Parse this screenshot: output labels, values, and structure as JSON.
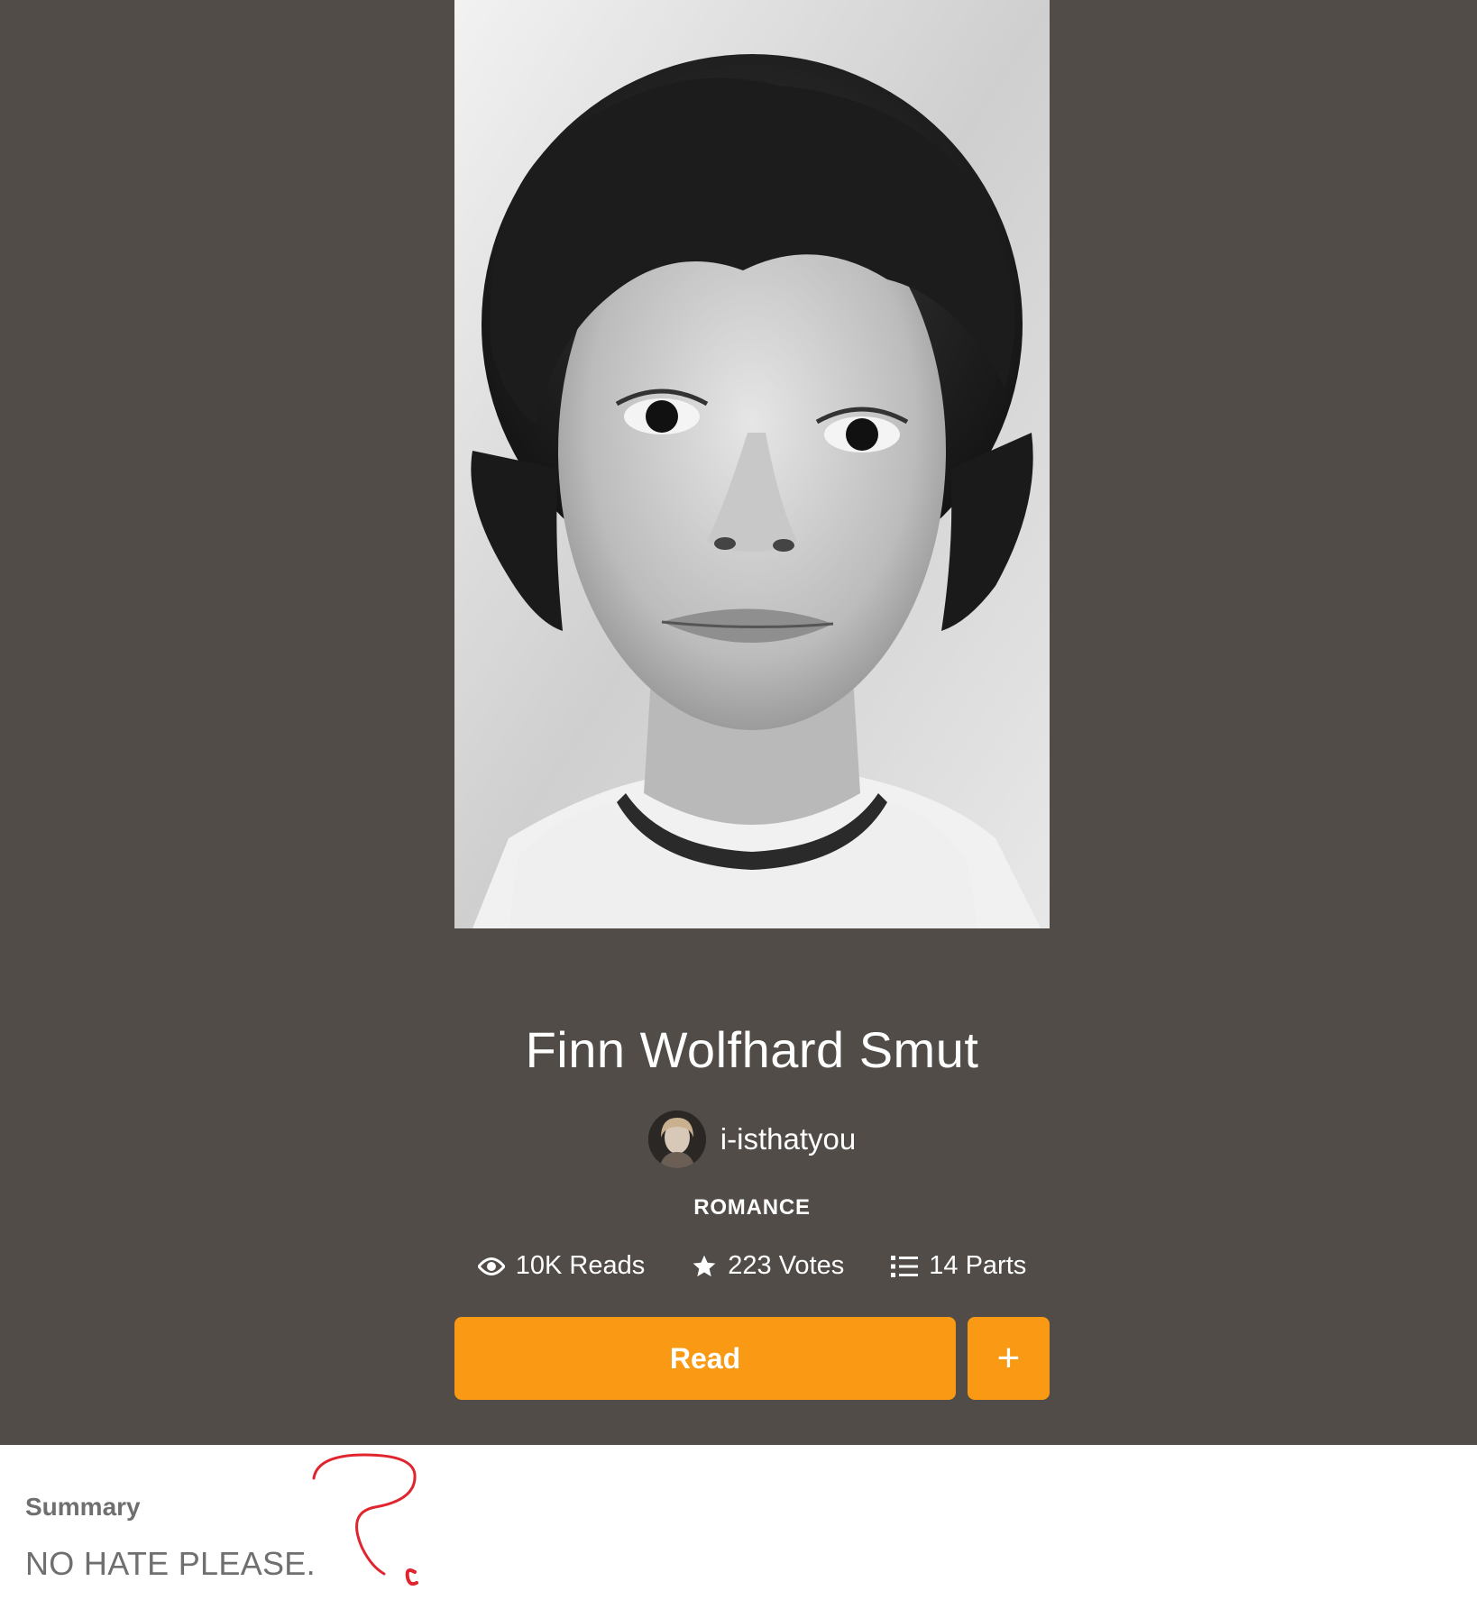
{
  "story": {
    "title": "Finn Wolfhard Smut",
    "author": "i-isthatyou",
    "category": "ROMANCE",
    "stats": {
      "reads": "10K Reads",
      "votes": "223 Votes",
      "parts": "14 Parts"
    }
  },
  "actions": {
    "read_label": "Read",
    "add_label": "+"
  },
  "summary": {
    "label": "Summary",
    "text": "NO HATE PLEASE."
  },
  "icons": {
    "reads": "eye-icon",
    "votes": "star-icon",
    "parts": "list-icon",
    "add": "plus-icon"
  },
  "colors": {
    "hero_background": "#514c47",
    "accent": "#fa9a14",
    "summary_text": "#6f6f6f",
    "scribble": "#e0252f"
  }
}
